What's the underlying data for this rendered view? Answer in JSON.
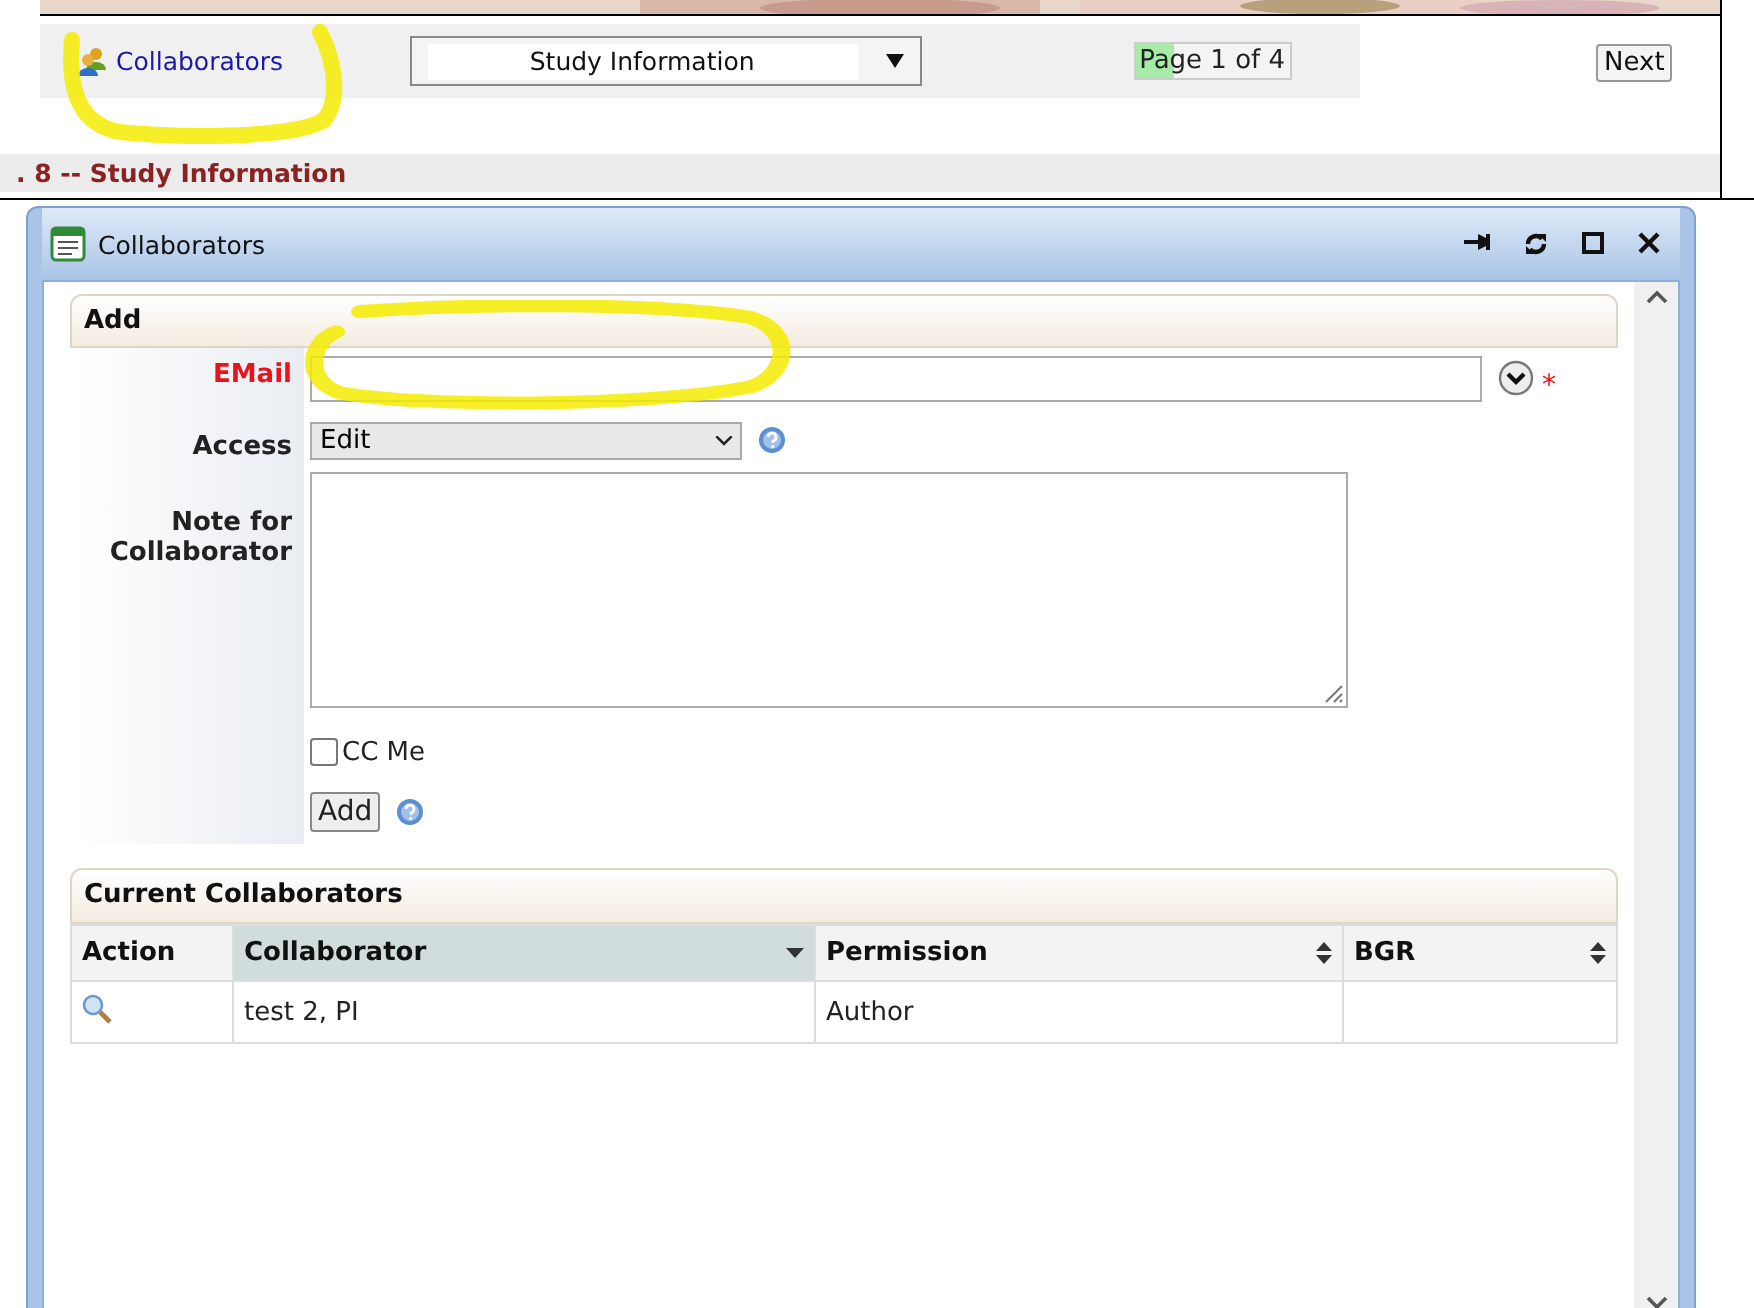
{
  "toolbar": {
    "link": "Collaborators",
    "section_select": "Study Information",
    "page": {
      "text": "Page 1 of 4",
      "level": 0.25
    },
    "next": "Next"
  },
  "section_heading": ". 8 -- Study Information",
  "dialog": {
    "title": "Collaborators",
    "add": {
      "title": "Add",
      "email": {
        "label": "EMail",
        "required": true,
        "required_mark": "*"
      },
      "access": {
        "label": "Access",
        "value": "Edit"
      },
      "note": {
        "label": "Note for Collaborator"
      },
      "cc_me": {
        "label": "CC Me",
        "checked": false
      },
      "add_button": "Add"
    },
    "current": {
      "title": "Current Collaborators",
      "columns": [
        {
          "label": "Action",
          "sortable": false,
          "sorted": false
        },
        {
          "label": "Collaborator",
          "sortable": true,
          "sorted": true
        },
        {
          "label": "Permission",
          "sortable": true,
          "sorted": false
        },
        {
          "label": "BGR",
          "sortable": true,
          "sorted": false
        }
      ],
      "rows": [
        {
          "collaborator": "test 2, PI",
          "permission": "Author"
        }
      ]
    }
  }
}
